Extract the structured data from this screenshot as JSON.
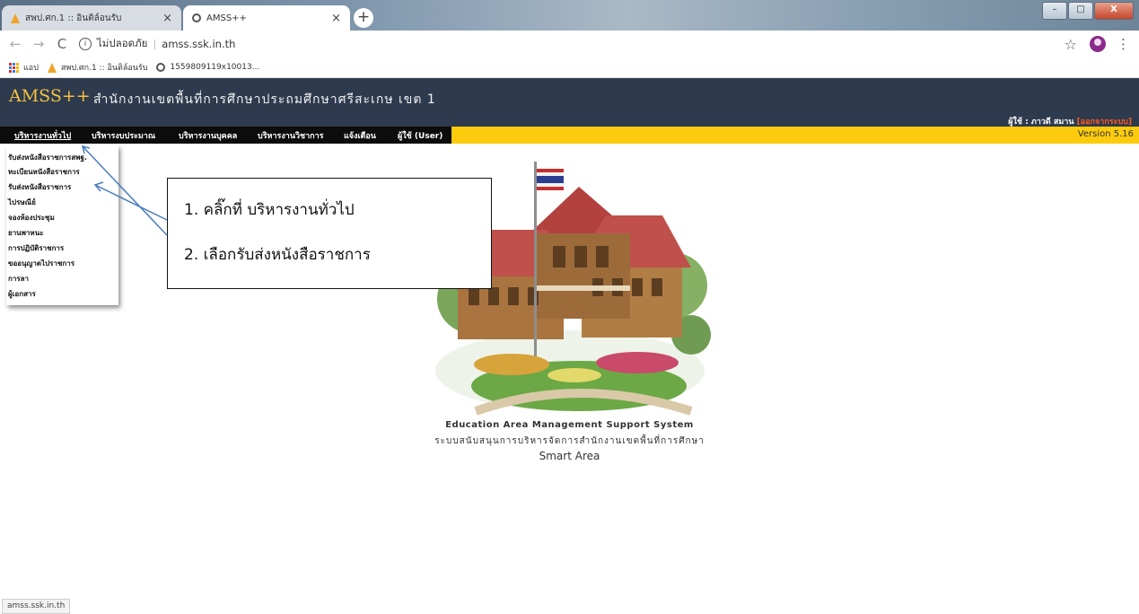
{
  "browser": {
    "tabs": [
      {
        "title": "สพป.ศก.1 :: อินติล์อนรับ",
        "active": false,
        "icon": "cone-icon"
      },
      {
        "title": "AMSS++",
        "active": true,
        "icon": "globe-icon"
      }
    ],
    "tab_close_glyph": "×",
    "new_tab_glyph": "+",
    "window_controls": [
      "–",
      "□",
      "X"
    ],
    "nav": {
      "back": "←",
      "forward": "→",
      "reload": "C"
    },
    "security_label": "ไม่ปลอดภัย",
    "url": "amss.ssk.in.th",
    "bookmarks": [
      {
        "label": "แอป",
        "icon": "apps-grid-icon"
      },
      {
        "label": "สพป.ศก.1 :: อินติล์อนรับ",
        "icon": "cone-icon"
      },
      {
        "label": "1559809119x10013...",
        "icon": "globe-icon"
      }
    ],
    "icons": {
      "star": "☆",
      "kebab": "⋮"
    }
  },
  "site": {
    "logo": "AMSS++",
    "org": "สำนักงานเขตพื้นที่การศึกษาประถมศึกษาศรีสะเกษ เขต 1",
    "user_label": "ผู้ใช้ : ภาวดี สมาน",
    "logout": "[ออกจากระบบ]",
    "version": "Version 5.16",
    "colors": {
      "header_bg": "#2e3a4d",
      "logo": "#f4c242",
      "menubar": "#fccb0d",
      "menu_dark": "#0c0c0c",
      "logout": "#ff5b1f"
    }
  },
  "menu": [
    {
      "label": "บริหารงานทั่วไป",
      "current": true
    },
    {
      "label": "บริหารงบประมาณ"
    },
    {
      "label": "บริหารงานบุคคล"
    },
    {
      "label": "บริหารงานวิชาการ"
    },
    {
      "label": "แจ้งเตือน"
    },
    {
      "label": "ผู้ใช้ (User)"
    }
  ],
  "dropdown": [
    "รับส่งหนังสือราชการสพฐ.",
    "ทะเบียนหนังสือราชการ",
    "รับส่งหนังสือราชการ",
    "ไปรษณีย์",
    "จองห้องประชุม",
    "ยานพาหนะ",
    "การปฏิบัติราชการ",
    "ขออนุญาตไปราชการ",
    "การลา",
    "ผู้เอกสาร"
  ],
  "main": {
    "tagline_en": "Education Area Management Support System",
    "tagline_th": "ระบบสนับสนุนการบริหารจัดการสำนักงานเขตพื้นที่การศึกษา",
    "tagline_smart": "Smart Area",
    "illustration": "thai-wooden-building-with-flag"
  },
  "callout": {
    "line1": "1. คลิ๊กที่ บริหารงานทั่วไป",
    "line2": "2. เลือกรับส่งหนังสือราชการ",
    "arrow_color": "#4a7cbf"
  },
  "status_bar": {
    "url": "amss.ssk.in.th"
  }
}
